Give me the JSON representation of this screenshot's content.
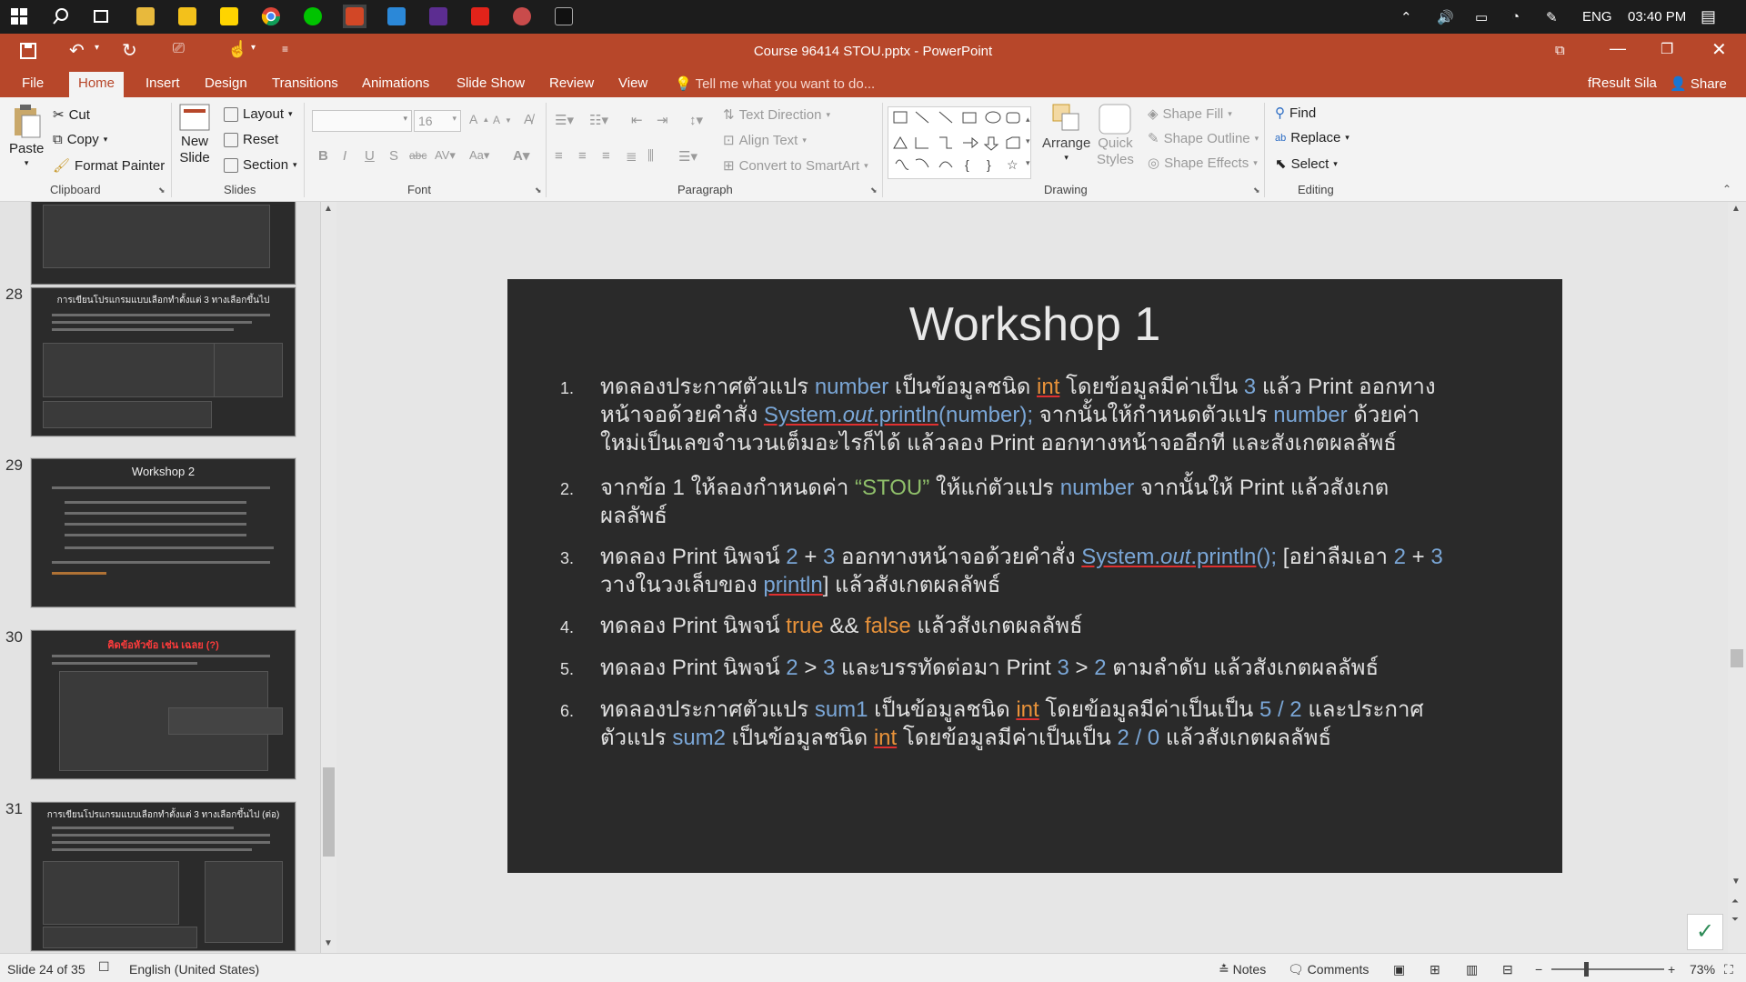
{
  "taskbar": {
    "language": "ENG",
    "time": "03:40 PM"
  },
  "window": {
    "title": "Course 96414 STOU.pptx - PowerPoint",
    "user": "fResult Sila",
    "share_label": "Share"
  },
  "tabs": [
    "File",
    "Home",
    "Insert",
    "Design",
    "Transitions",
    "Animations",
    "Slide Show",
    "Review",
    "View"
  ],
  "tell_me_placeholder": "Tell me what you want to do...",
  "ribbon": {
    "clipboard": {
      "paste": "Paste",
      "cut": "Cut",
      "copy": "Copy",
      "format_painter": "Format Painter",
      "label": "Clipboard"
    },
    "slides": {
      "new_slide_1": "New",
      "new_slide_2": "Slide",
      "layout": "Layout",
      "reset": "Reset",
      "section": "Section",
      "label": "Slides"
    },
    "font": {
      "size": "16",
      "label": "Font"
    },
    "paragraph": {
      "text_direction": "Text Direction",
      "align_text": "Align Text",
      "convert_smartart": "Convert to SmartArt",
      "label": "Paragraph"
    },
    "drawing": {
      "arrange": "Arrange",
      "quick_styles_1": "Quick",
      "quick_styles_2": "Styles",
      "shape_fill": "Shape Fill",
      "shape_outline": "Shape Outline",
      "shape_effects": "Shape Effects",
      "label": "Drawing"
    },
    "editing": {
      "find": "Find",
      "replace": "Replace",
      "select": "Select",
      "label": "Editing"
    }
  },
  "thumbnails": [
    {
      "number": "28",
      "title": "การเขียนโปรแกรมแบบเลือกทำตั้งแต่   3 ทางเลือกขึ้นไป"
    },
    {
      "number": "29",
      "title": "Workshop 2"
    },
    {
      "number": "30",
      "title": "คิดข้อหัวข้อ เช่น เฉลย (?)"
    },
    {
      "number": "31",
      "title": "การเขียนโปรแกรมแบบเลือกทำตั้งแต่   3 ทางเลือกขึ้นไป (ต่อ)"
    }
  ],
  "slide": {
    "title": "Workshop 1",
    "items": [
      {
        "num": "1."
      },
      {
        "num": "2."
      },
      {
        "num": "3."
      },
      {
        "num": "4."
      },
      {
        "num": "5."
      },
      {
        "num": "6."
      }
    ]
  },
  "status": {
    "slide_info": "Slide 24 of 35",
    "language": "English (United States)",
    "notes": "Notes",
    "comments": "Comments",
    "zoom": "73%"
  }
}
